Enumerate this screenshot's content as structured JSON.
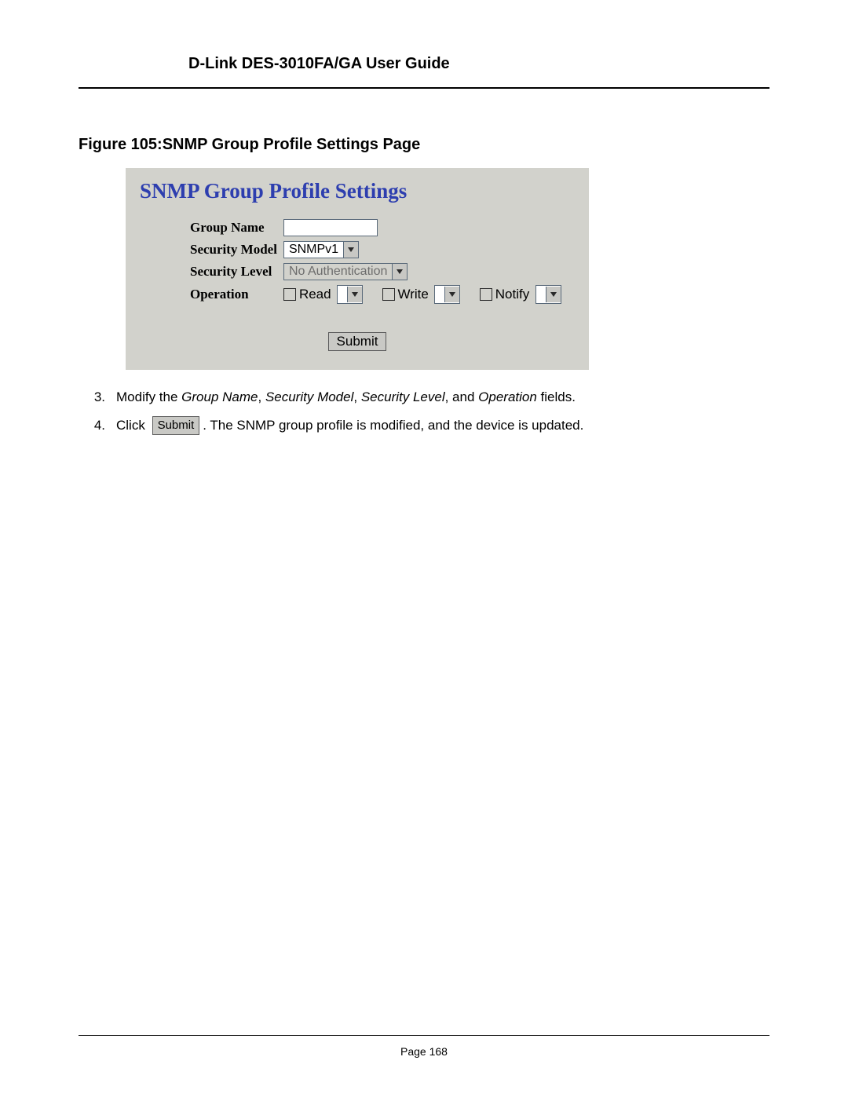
{
  "header": {
    "title": "D-Link DES-3010FA/GA User Guide"
  },
  "figure": {
    "caption": "Figure 105:SNMP Group Profile Settings Page"
  },
  "panel": {
    "title": "SNMP Group Profile Settings",
    "labels": {
      "group_name": "Group Name",
      "security_model": "Security Model",
      "security_level": "Security Level",
      "operation": "Operation"
    },
    "values": {
      "group_name": "",
      "security_model": "SNMPv1",
      "security_level": "No Authentication"
    },
    "operations": {
      "read": "Read",
      "write": "Write",
      "notify": "Notify"
    },
    "submit_label": "Submit"
  },
  "steps": {
    "s3_num": "3.",
    "s3_a": "Modify the ",
    "s3_i1": "Group Name",
    "s3_b": ", ",
    "s3_i2": "Security Model",
    "s3_c": ", ",
    "s3_i3": "Security Level",
    "s3_d": ", and ",
    "s3_i4": "Operation",
    "s3_e": " fields.",
    "s4_num": "4.",
    "s4_a": "Click ",
    "s4_btn": "Submit",
    "s4_b": ". The SNMP group profile is modified, and the device is updated."
  },
  "footer": {
    "page": "Page 168"
  }
}
